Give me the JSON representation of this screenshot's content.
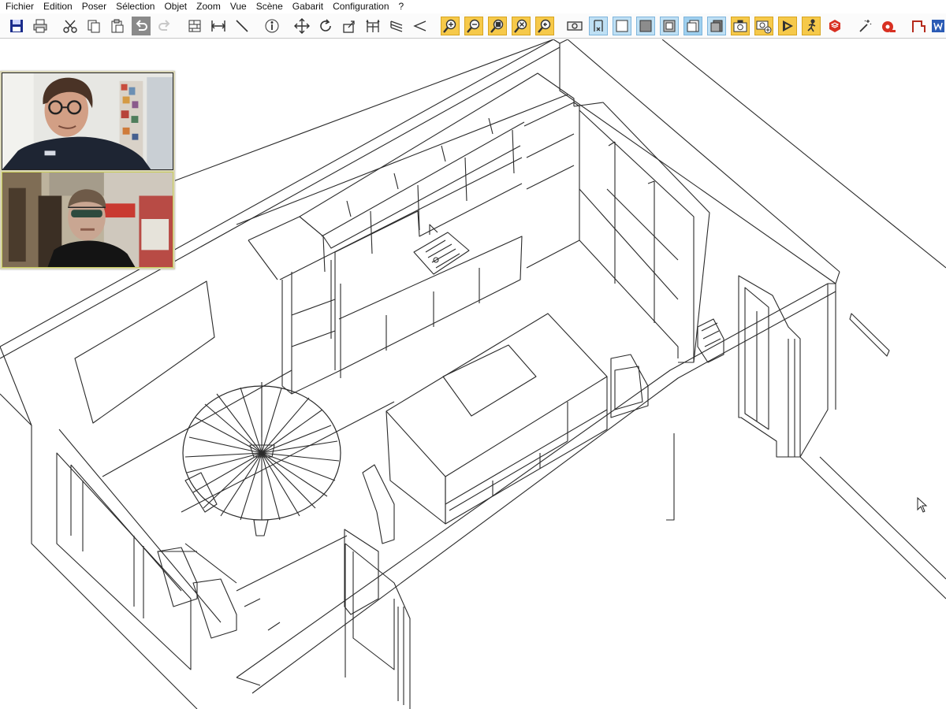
{
  "menubar": {
    "items": [
      {
        "id": "fichier",
        "label": "Fichier"
      },
      {
        "id": "edition",
        "label": "Edition"
      },
      {
        "id": "poser",
        "label": "Poser"
      },
      {
        "id": "selection",
        "label": "Sélection"
      },
      {
        "id": "objet",
        "label": "Objet"
      },
      {
        "id": "zoom",
        "label": "Zoom"
      },
      {
        "id": "vue",
        "label": "Vue"
      },
      {
        "id": "scene",
        "label": "Scène"
      },
      {
        "id": "gabarit",
        "label": "Gabarit"
      },
      {
        "id": "configuration",
        "label": "Configuration"
      },
      {
        "id": "help",
        "label": "?"
      }
    ]
  },
  "toolbar": {
    "icons": [
      "save-icon",
      "print-icon",
      "cut-icon",
      "copy-icon",
      "paste-icon",
      "undo-icon",
      "redo-icon",
      "wall-icon",
      "dimension-icon",
      "line-icon",
      "info-icon",
      "move-icon",
      "rotate-icon",
      "push-icon",
      "fence-icon",
      "stair-icon",
      "triangle-icon",
      "zoom-in-icon",
      "zoom-out-icon",
      "zoom-window-icon",
      "zoom-extents-icon",
      "zoom-previous-icon",
      "money-icon",
      "front-view-icon",
      "wireframe-view-icon",
      "solid-view-icon",
      "texture-view-icon",
      "shaded-view-icon",
      "xray-view-icon",
      "camera-icon",
      "camera-add-icon",
      "render-icon",
      "walk-icon",
      "sketchup-icon",
      "magic-wand-icon",
      "measure-tape-icon",
      "export-icon",
      "word-icon"
    ]
  },
  "colors": {
    "toolbar_yellow": "#f6c94a",
    "toolbar_blue": "#bfe0f4",
    "video_border_active": "#c9cd5a",
    "line": "#2a2a2a"
  }
}
